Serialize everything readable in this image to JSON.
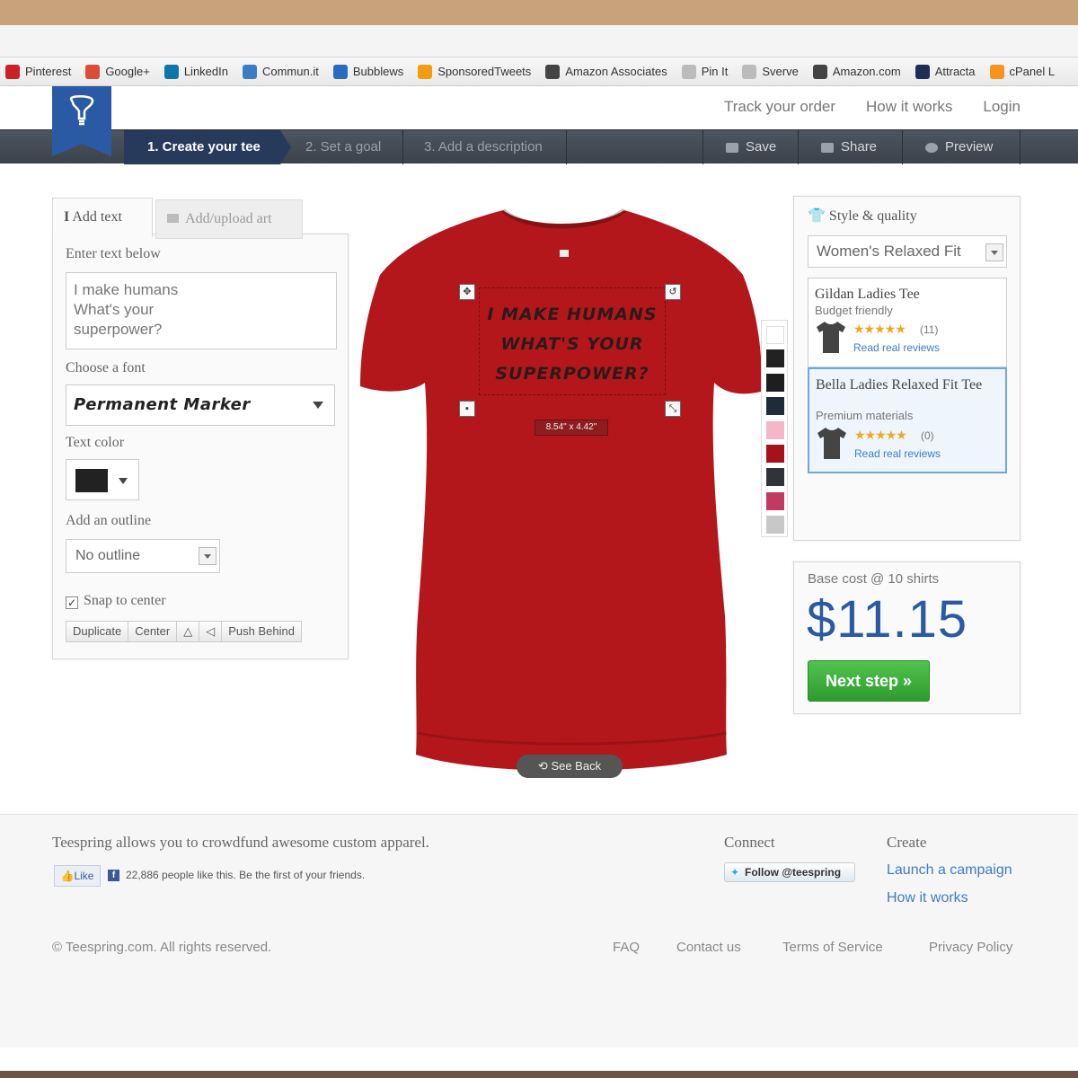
{
  "bookmarks": [
    {
      "label": "Pinterest",
      "color": "#cb2027"
    },
    {
      "label": "Google+",
      "color": "#dd4b39"
    },
    {
      "label": "LinkedIn",
      "color": "#0e76a8"
    },
    {
      "label": "Commun.it",
      "color": "#3b7dc4"
    },
    {
      "label": "Bubblews",
      "color": "#2a6bbf"
    },
    {
      "label": "SponsoredTweets",
      "color": "#f39c12"
    },
    {
      "label": "Amazon Associates",
      "color": "#444444"
    },
    {
      "label": "Pin It",
      "color": "#bbbbbb"
    },
    {
      "label": "Sverve",
      "color": "#bbbbbb"
    },
    {
      "label": "Amazon.com",
      "color": "#444444"
    },
    {
      "label": "Attracta",
      "color": "#1f2e55"
    },
    {
      "label": "cPanel L",
      "color": "#f7941d"
    }
  ],
  "header": {
    "links": [
      "Track your order",
      "How it works",
      "Login"
    ],
    "brand_color": "#2b5aa5"
  },
  "steps": {
    "step1": "1. Create your tee",
    "step2": "2. Set a goal",
    "step3": "3. Add a description",
    "save": "Save",
    "share": "Share",
    "preview": "Preview"
  },
  "left_panel": {
    "tab_text": "Add text",
    "tab_art": "Add/upload art",
    "enter_text_label": "Enter text below",
    "text_value": "I make humans\nWhat's your\nsuperpower?",
    "font_label": "Choose a font",
    "font_value": "Permanent Marker",
    "text_color_label": "Text color",
    "text_color_value": "#222222",
    "outline_label": "Add an outline",
    "outline_value": "No outline",
    "snap_label": "Snap to center",
    "snap_checked": true,
    "buttons": {
      "duplicate": "Duplicate",
      "center": "Center",
      "push_behind": "Push Behind"
    }
  },
  "design": {
    "text": "I make humans What's your superpower?",
    "shirt_color": "#b3171b",
    "dimensions": "8.54\" x 4.42\"",
    "see_back": "See Back"
  },
  "color_swatches": [
    "#ffffff",
    "#222222",
    "#1e1e1e",
    "#1f2a3a",
    "#f4b6c8",
    "#a5121a",
    "#30333a",
    "#c23a60",
    "#c8c8c8"
  ],
  "right_panel": {
    "title": "Style & quality",
    "style_value": "Women's Relaxed Fit",
    "products": [
      {
        "name": "Gildan Ladies Tee",
        "sub": "Budget friendly",
        "stars": "★★★★★",
        "count": "(11)",
        "link": "Read real reviews"
      },
      {
        "name": "Bella Ladies Relaxed Fit Tee",
        "sub": "Premium materials",
        "stars": "★★★★★",
        "count": "(0)",
        "link": "Read real reviews"
      }
    ]
  },
  "pricing": {
    "base_cost": "Base cost @ 10 shirts",
    "price": "$11.15",
    "next": "Next step »"
  },
  "footer": {
    "tagline": "Teespring allows you to crowdfund awesome custom apparel.",
    "like": "Like",
    "like_text": "22,886 people like this. Be the first of your friends.",
    "connect": "Connect",
    "follow": "Follow @teespring",
    "create": "Create",
    "launch": "Launch a campaign",
    "how": "How it works",
    "copyright": "© Teespring.com. All rights reserved.",
    "faq": "FAQ",
    "contact": "Contact us",
    "terms": "Terms of Service",
    "privacy": "Privacy Policy"
  }
}
